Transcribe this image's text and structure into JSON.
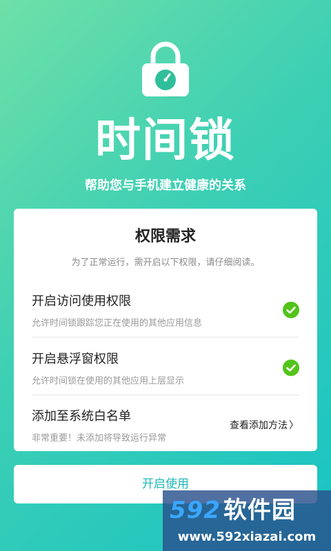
{
  "app": {
    "title": "时间锁",
    "tagline": "帮助您与手机建立健康的关系"
  },
  "permissions_card": {
    "title": "权限需求",
    "description": "为了正常运行，需开启以下权限，请仔细阅读。",
    "items": [
      {
        "title": "开启访问使用权限",
        "subtitle": "允许时间锁跟踪您正在使用的其他应用信息",
        "status": "granted"
      },
      {
        "title": "开启悬浮窗权限",
        "subtitle": "允许时间锁在使用的其他应用上层显示",
        "status": "granted"
      },
      {
        "title": "添加至系统白名单",
        "subtitle": "非常重要！未添加将导致运行异常",
        "action_label": "查看添加方法"
      }
    ]
  },
  "start_button": {
    "label": "开启使用"
  },
  "watermark": {
    "logo_digits": "592",
    "logo_text": "软件园",
    "url": "www.592xiazai.com"
  },
  "colors": {
    "accent": "#1fb8b6",
    "check_green": "#52c41a",
    "background_start": "#6ee0a8",
    "background_end": "#18c3c4"
  },
  "icons": {
    "lock": "lock-icon",
    "check": "check-circle-icon",
    "chevron": "chevron-right-icon"
  }
}
